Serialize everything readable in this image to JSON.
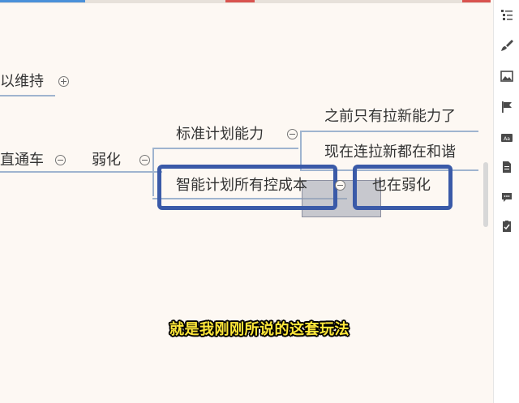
{
  "colors": {
    "accent": "#3a5aa8",
    "canvas": "#fdf8f3",
    "subtitle": "#ffe83a"
  },
  "mindmap": {
    "node_partial_top": "以维持",
    "node_partial_left": "直通车",
    "node_weaken": "弱化",
    "node_standard_plan": "标准计划能力",
    "node_smart_plan": "智能计划所有控成本",
    "node_no_more": "之前只有拉新能力了",
    "node_now_all": "现在连拉新都在和谐",
    "node_also_weaken": "也在弱化"
  },
  "subtitle": "就是我刚刚所说的这套玩法",
  "panel": {
    "icons": [
      "outline-icon",
      "brush-icon",
      "image-icon",
      "flag-icon",
      "label-icon",
      "note-icon",
      "comment-icon",
      "task-icon"
    ]
  }
}
